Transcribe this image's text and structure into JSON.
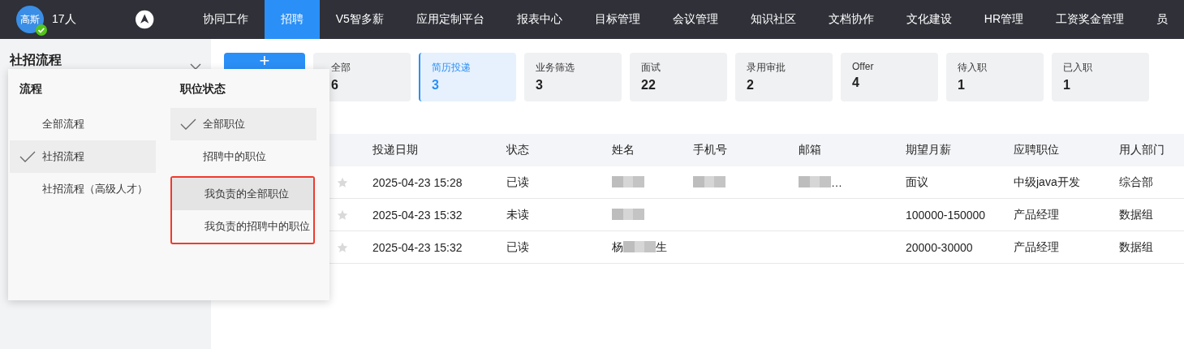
{
  "nav": {
    "avatar_text": "高斯",
    "online": true,
    "member_count": "17人",
    "items": [
      {
        "label": "协同工作",
        "selected": false
      },
      {
        "label": "招聘",
        "selected": true
      },
      {
        "label": "V5智多薪",
        "selected": false
      },
      {
        "label": "应用定制平台",
        "selected": false
      },
      {
        "label": "报表中心",
        "selected": false
      },
      {
        "label": "目标管理",
        "selected": false
      },
      {
        "label": "会议管理",
        "selected": false
      },
      {
        "label": "知识社区",
        "selected": false
      },
      {
        "label": "文档协作",
        "selected": false
      },
      {
        "label": "文化建设",
        "selected": false
      },
      {
        "label": "HR管理",
        "selected": false
      },
      {
        "label": "工资奖金管理",
        "selected": false
      },
      {
        "label": "员",
        "selected": false
      }
    ]
  },
  "sidebar": {
    "title": "社招流程"
  },
  "dropdown": {
    "columns": [
      {
        "heading": "流程",
        "items": [
          {
            "label": "全部流程",
            "selected": false,
            "hovered": false,
            "boxed": false
          },
          {
            "label": "社招流程",
            "selected": true,
            "hovered": false,
            "boxed": false
          },
          {
            "label": "社招流程（高级人才）",
            "selected": false,
            "hovered": false,
            "boxed": false
          }
        ]
      },
      {
        "heading": "职位状态",
        "items": [
          {
            "label": "全部职位",
            "selected": true,
            "hovered": false,
            "boxed": false
          },
          {
            "label": "招聘中的职位",
            "selected": false,
            "hovered": false,
            "boxed": false
          },
          {
            "label": "我负责的全部职位",
            "selected": false,
            "hovered": true,
            "boxed": true
          },
          {
            "label": "我负责的招聘中的职位",
            "selected": false,
            "hovered": false,
            "boxed": true
          }
        ]
      }
    ]
  },
  "add_button": {
    "label": "+"
  },
  "stage_cards": [
    {
      "label": "全部",
      "count": "6",
      "selected": false
    },
    {
      "label": "简历投递",
      "count": "3",
      "selected": true
    },
    {
      "label": "业务筛选",
      "count": "3",
      "selected": false
    },
    {
      "label": "面试",
      "count": "22",
      "selected": false
    },
    {
      "label": "录用审批",
      "count": "2",
      "selected": false
    },
    {
      "label": "Offer",
      "count": "4",
      "selected": false
    },
    {
      "label": "待入职",
      "count": "1",
      "selected": false
    },
    {
      "label": "已入职",
      "count": "1",
      "selected": false
    }
  ],
  "table": {
    "columns": [
      "投递日期",
      "状态",
      "姓名",
      "手机号",
      "邮箱",
      "期望月薪",
      "应聘职位",
      "用人部门"
    ],
    "rows": [
      {
        "starred": false,
        "cells": [
          "2025-04-23 15:28",
          "已读",
          {
            "redacted": true
          },
          {
            "redacted": true
          },
          {
            "after": "…",
            "redacted": true
          },
          "面议",
          "中级java开发",
          "综合部"
        ]
      },
      {
        "starred": false,
        "cells": [
          "2025-04-23 15:32",
          "未读",
          {
            "redacted": true
          },
          null,
          null,
          "100000-150000",
          "产品经理",
          "数据组"
        ]
      },
      {
        "starred": false,
        "cells": [
          "2025-04-23 15:32",
          "已读",
          {
            "before": "杨",
            "after": "生",
            "redacted": true
          },
          null,
          null,
          "20000-30000",
          "产品经理",
          "数据组"
        ]
      }
    ]
  }
}
